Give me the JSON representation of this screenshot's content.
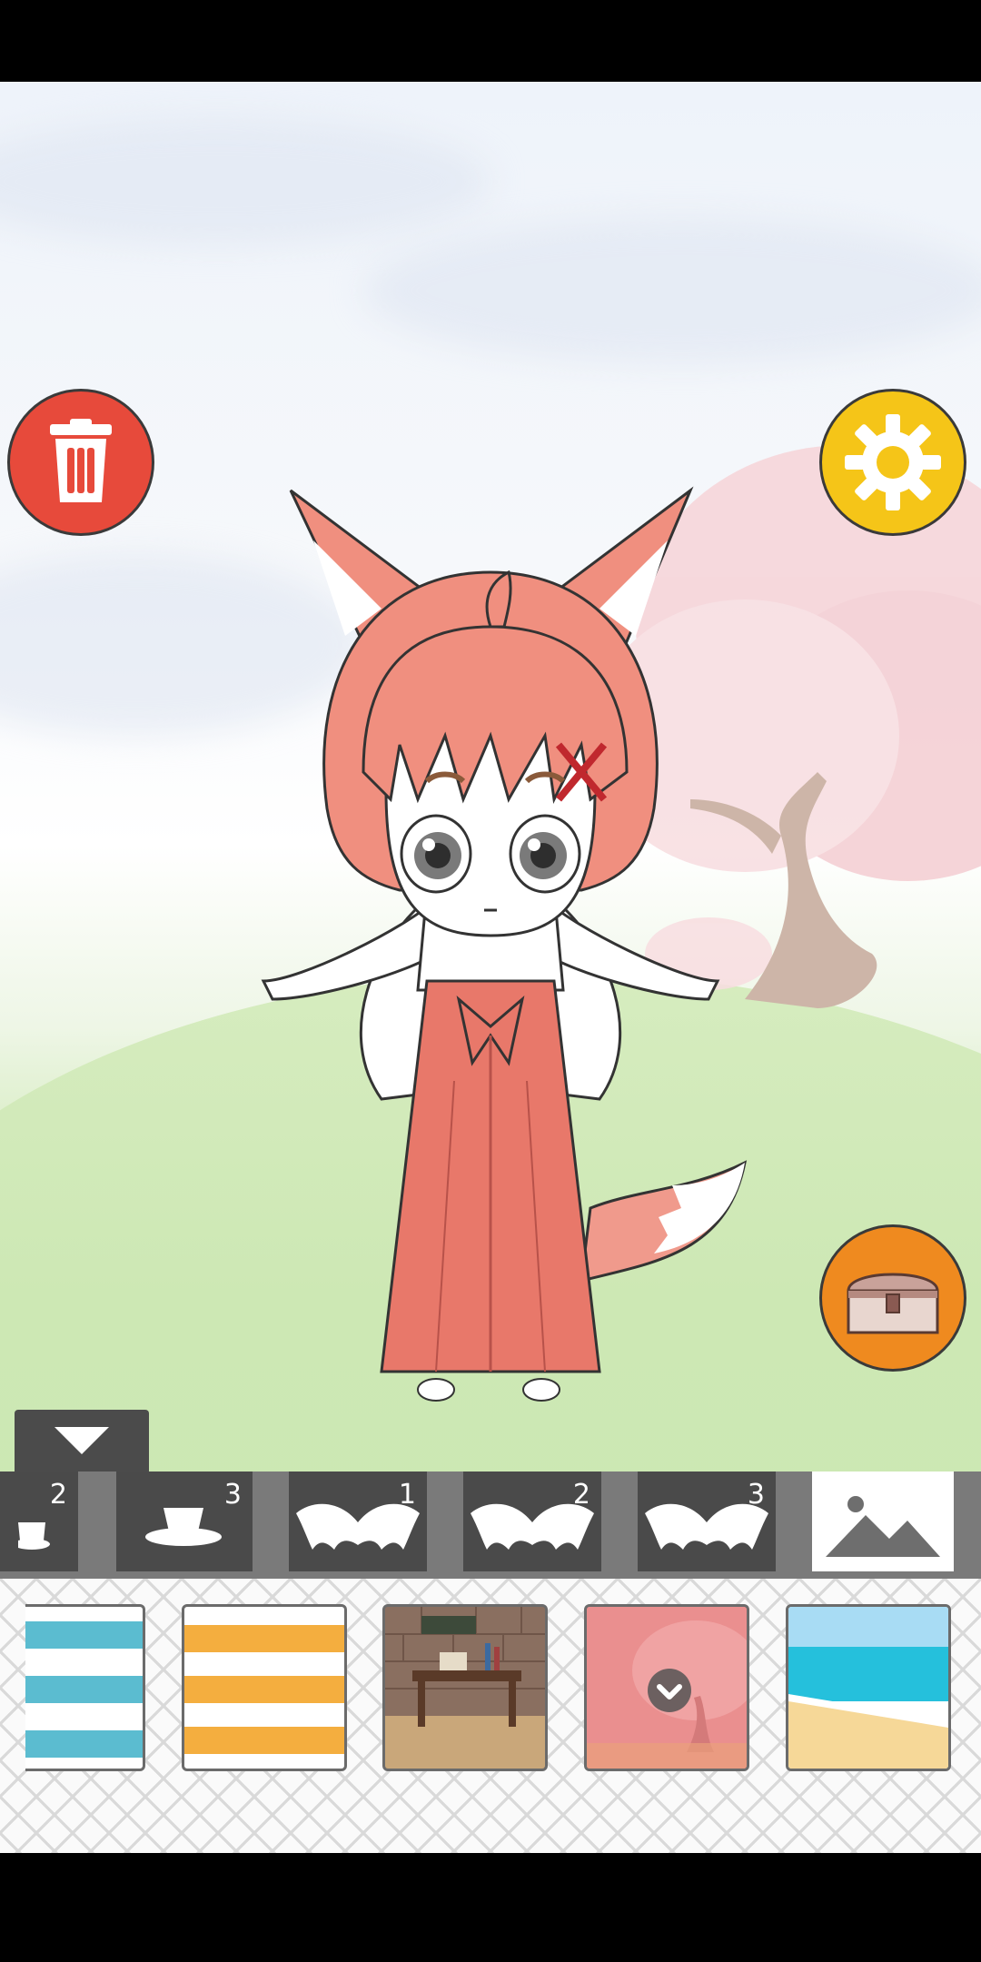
{
  "colors": {
    "trash": "#e74a3b",
    "settings": "#f5c518",
    "chest": "#ef8a1f",
    "tab_dark": "#4a4a4a",
    "tab_active": "#ffffff",
    "hair": "#f08f7f",
    "hakama": "#e8786a"
  },
  "toolbar": {
    "trash_icon": "trash-icon",
    "settings_icon": "gear-icon",
    "chest_icon": "treasure-chest-icon",
    "collapse_icon": "triangle-down-icon"
  },
  "categories": [
    {
      "icon": "cup-icon",
      "number": "2"
    },
    {
      "icon": "cup-icon",
      "number": "3"
    },
    {
      "icon": "wings-icon",
      "number": "1"
    },
    {
      "icon": "wings-icon",
      "number": "2"
    },
    {
      "icon": "wings-icon",
      "number": "3"
    },
    {
      "icon": "landscape-icon",
      "number": "",
      "active": true
    }
  ],
  "backgrounds": [
    {
      "name": "blue-stripes",
      "colors": [
        "#5bbcd0",
        "#ffffff"
      ]
    },
    {
      "name": "orange-stripes",
      "colors": [
        "#f4ae3f",
        "#ffffff"
      ]
    },
    {
      "name": "study-room"
    },
    {
      "name": "cherry-blossom",
      "selected": true
    },
    {
      "name": "beach"
    }
  ]
}
